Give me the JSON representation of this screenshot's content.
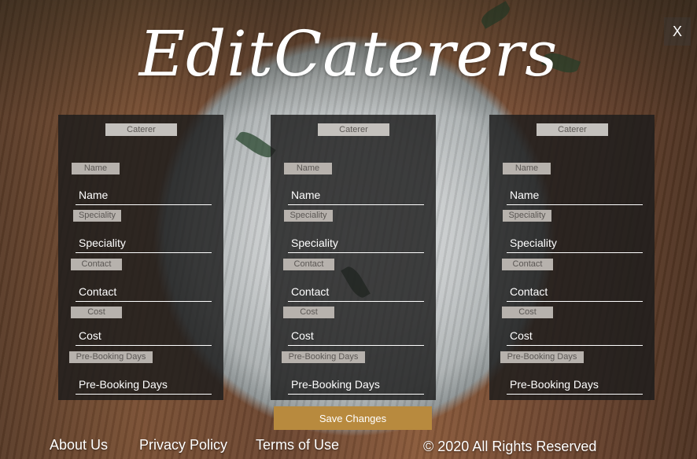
{
  "window": {
    "close_label": "X"
  },
  "header": {
    "title": "EditCaterers"
  },
  "cards": [
    {
      "tag": "Caterer",
      "fields": [
        {
          "label": "Name",
          "placeholder": "Name"
        },
        {
          "label": "Speciality",
          "placeholder": "Speciality"
        },
        {
          "label": "Contact",
          "placeholder": "Contact"
        },
        {
          "label": "Cost",
          "placeholder": "Cost"
        },
        {
          "label": "Pre-Booking Days",
          "placeholder": "Pre-Booking Days"
        }
      ]
    },
    {
      "tag": "Caterer",
      "fields": [
        {
          "label": "Name",
          "placeholder": "Name"
        },
        {
          "label": "Speciality",
          "placeholder": "Speciality"
        },
        {
          "label": "Contact",
          "placeholder": "Contact"
        },
        {
          "label": "Cost",
          "placeholder": "Cost"
        },
        {
          "label": "Pre-Booking Days",
          "placeholder": "Pre-Booking Days"
        }
      ]
    },
    {
      "tag": "Caterer",
      "fields": [
        {
          "label": "Name",
          "placeholder": "Name"
        },
        {
          "label": "Speciality",
          "placeholder": "Speciality"
        },
        {
          "label": "Contact",
          "placeholder": "Contact"
        },
        {
          "label": "Cost",
          "placeholder": "Cost"
        },
        {
          "label": "Pre-Booking Days",
          "placeholder": "Pre-Booking Days"
        }
      ]
    }
  ],
  "actions": {
    "save_label": "Save Changes"
  },
  "footer": {
    "about": "About Us",
    "privacy": "Privacy Policy",
    "terms": "Terms of Use",
    "copyright": "© 2020 All Rights Reserved"
  },
  "colors": {
    "accent": "#b88a3e",
    "card_bg": "#1c1c1c",
    "tag_bg": "#c4c1bd"
  }
}
